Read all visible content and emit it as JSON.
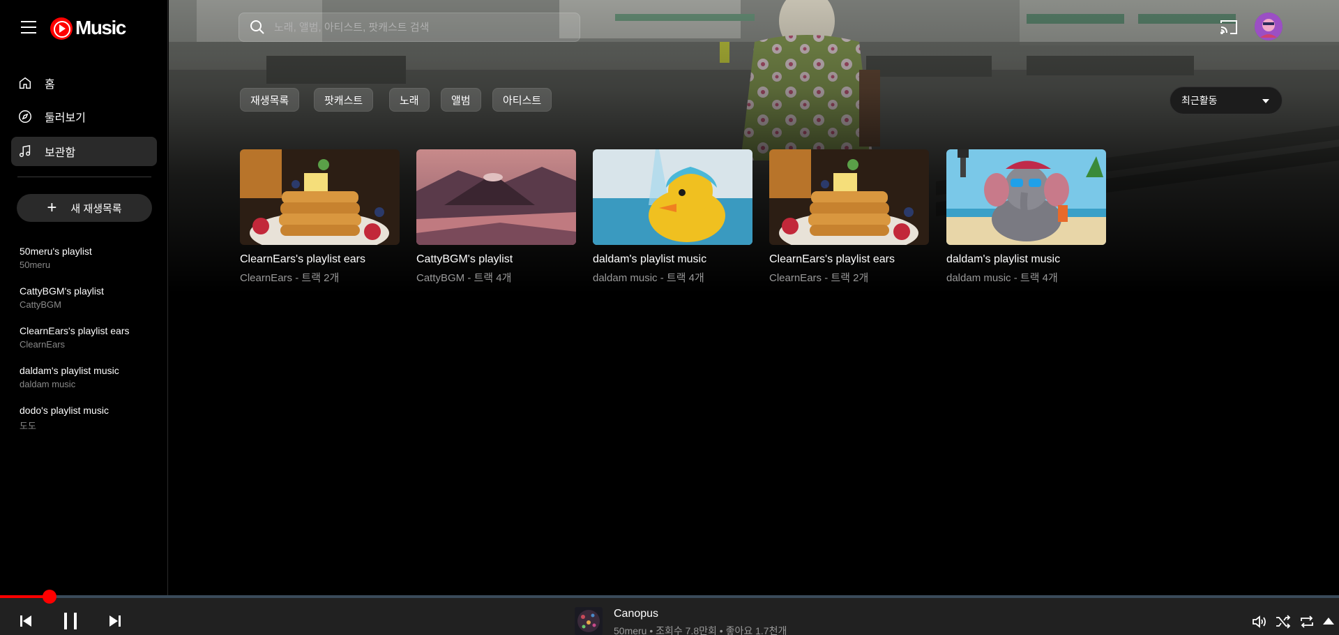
{
  "app": {
    "logo_text": "Music"
  },
  "sidebar": {
    "nav": [
      {
        "label": "홈",
        "icon": "home-icon"
      },
      {
        "label": "둘러보기",
        "icon": "compass-icon"
      },
      {
        "label": "보관함",
        "icon": "music-note-icon",
        "active": true
      }
    ],
    "new_playlist_label": "새 재생목록",
    "playlists": [
      {
        "title": "50meru's playlist",
        "subtitle": "50meru"
      },
      {
        "title": "CattyBGM's playlist",
        "subtitle": "CattyBGM"
      },
      {
        "title": "ClearnEars's playlist ears",
        "subtitle": "ClearnEars"
      },
      {
        "title": "daldam's playlist music",
        "subtitle": "daldam music"
      },
      {
        "title": "dodo's playlist music",
        "subtitle": "도도"
      }
    ]
  },
  "search": {
    "placeholder": "노래, 앨범, 아티스트, 팟캐스트 검색"
  },
  "chips": [
    "재생목록",
    "팟캐스트",
    "노래",
    "앨범",
    "아티스트"
  ],
  "sort": {
    "selected": "최근활동"
  },
  "cards": [
    {
      "title": "ClearnEars's playlist ears",
      "subtitle": "ClearnEars - 트랙 2개",
      "art": "pancakes"
    },
    {
      "title": "CattyBGM's playlist",
      "subtitle": "CattyBGM - 트랙 4개",
      "art": "volcano"
    },
    {
      "title": "daldam's playlist music",
      "subtitle": "daldam music - 트랙 4개",
      "art": "duck"
    },
    {
      "title": "ClearnEars's playlist ears",
      "subtitle": "ClearnEars - 트랙 2개",
      "art": "pancakes"
    },
    {
      "title": "daldam's playlist music",
      "subtitle": "daldam music - 트랙 4개",
      "art": "elephant"
    }
  ],
  "player": {
    "title": "Canopus",
    "subtitle": "50meru • 조회수 7.8만회 • 좋아요 1.7천개",
    "progress_fraction": 0.037,
    "accent_color": "#ff0000"
  }
}
